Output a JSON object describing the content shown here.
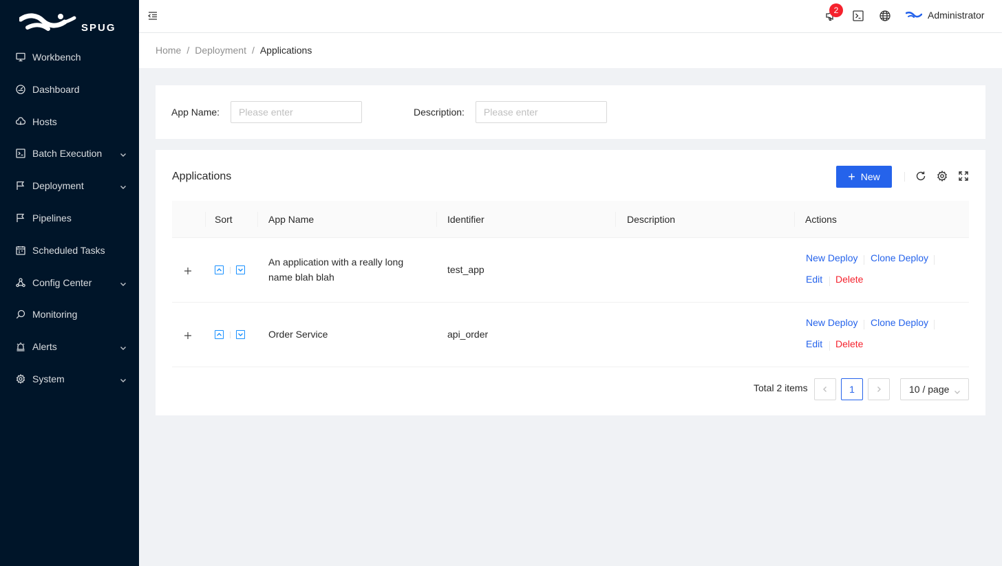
{
  "brand": {
    "name": "SPUG"
  },
  "sidebar": {
    "items": [
      {
        "label": "Workbench",
        "icon": "desktop-icon",
        "has_children": false
      },
      {
        "label": "Dashboard",
        "icon": "dashboard-icon",
        "has_children": false
      },
      {
        "label": "Hosts",
        "icon": "cloud-server-icon",
        "has_children": false
      },
      {
        "label": "Batch Execution",
        "icon": "code-icon",
        "has_children": true
      },
      {
        "label": "Deployment",
        "icon": "flag-icon",
        "has_children": true
      },
      {
        "label": "Pipelines",
        "icon": "flag-outline-icon",
        "has_children": false
      },
      {
        "label": "Scheduled Tasks",
        "icon": "schedule-icon",
        "has_children": false
      },
      {
        "label": "Config Center",
        "icon": "apartment-icon",
        "has_children": true
      },
      {
        "label": "Monitoring",
        "icon": "monitor-icon",
        "has_children": false
      },
      {
        "label": "Alerts",
        "icon": "alert-icon",
        "has_children": true
      },
      {
        "label": "System",
        "icon": "setting-icon",
        "has_children": true
      }
    ]
  },
  "header": {
    "notification_count": "2",
    "user": "Administrator"
  },
  "breadcrumb": {
    "home": "Home",
    "section": "Deployment",
    "current": "Applications",
    "separator": "/"
  },
  "search": {
    "app_name_label": "App Name",
    "app_name_placeholder": "Please enter",
    "description_label": "Description",
    "description_placeholder": "Please enter"
  },
  "table": {
    "title": "Applications",
    "new_button": "New",
    "columns": {
      "sort": "Sort",
      "app_name": "App Name",
      "identifier": "Identifier",
      "description": "Description",
      "actions": "Actions"
    },
    "rows": [
      {
        "app_name_line1": "An application with a really long",
        "app_name_line2": "name blah blah",
        "identifier": "test_app",
        "description": ""
      },
      {
        "app_name_line1": "Order Service",
        "app_name_line2": "",
        "identifier": "api_order",
        "description": ""
      }
    ],
    "actions": {
      "new_deploy": "New Deploy",
      "clone_deploy": "Clone Deploy",
      "edit": "Edit",
      "delete": "Delete"
    }
  },
  "pagination": {
    "total": "Total 2 items",
    "current_page": "1",
    "page_size": "10 / page"
  },
  "colors": {
    "sidebar_bg": "#001529",
    "primary": "#2563eb",
    "danger": "#f5222d",
    "page_bg": "#f0f2f5"
  }
}
